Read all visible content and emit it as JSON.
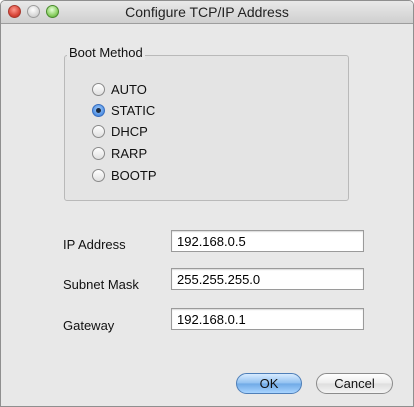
{
  "window": {
    "title": "Configure TCP/IP Address"
  },
  "boot_method": {
    "label": "Boot Method",
    "selected": "STATIC",
    "options": [
      {
        "label": "AUTO",
        "selected": false
      },
      {
        "label": "STATIC",
        "selected": true
      },
      {
        "label": "DHCP",
        "selected": false
      },
      {
        "label": "RARP",
        "selected": false
      },
      {
        "label": "BOOTP",
        "selected": false
      }
    ]
  },
  "fields": {
    "ip_address": {
      "label": "IP Address",
      "value": "192.168.0.5"
    },
    "subnet_mask": {
      "label": "Subnet Mask",
      "value": "255.255.255.0"
    },
    "gateway": {
      "label": "Gateway",
      "value": "192.168.0.1"
    }
  },
  "buttons": {
    "ok": "OK",
    "cancel": "Cancel"
  },
  "colors": {
    "default_button": "#8fc0f0",
    "selected_radio": "#4f8fe3"
  }
}
